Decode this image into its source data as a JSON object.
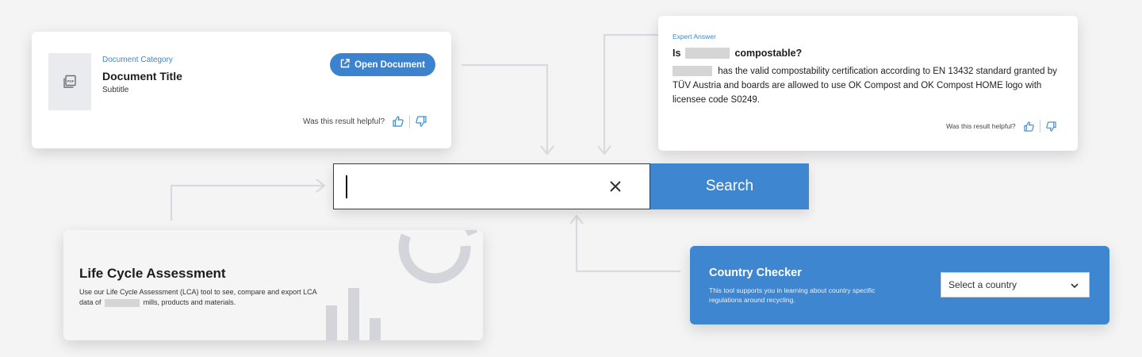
{
  "document_card": {
    "category": "Document Category",
    "title": "Document Title",
    "subtitle": "Subtitle",
    "thumb_icon": "pdf-file-icon",
    "open_button_icon": "external-link-icon",
    "open_button_label": "Open Document",
    "feedback_question": "Was this result helpful?",
    "thumbs_up_icon": "thumbs-up-icon",
    "thumbs_down_icon": "thumbs-down-icon"
  },
  "expert_card": {
    "label": "Expert Answer",
    "question_prefix": "Is",
    "question_suffix": "compostable?",
    "answer_text": "has the valid compostability certification according to EN 13432 standard granted by TÜV Austria and boards are allowed to use OK Compost and OK Compost HOME logo with licensee code S0249.",
    "feedback_question": "Was this result helpful?"
  },
  "search": {
    "input_value": "",
    "clear_icon": "close-icon",
    "button_label": "Search"
  },
  "lca_card": {
    "title": "Life Cycle Assessment",
    "desc_part1": "Use our Life Cycle Assessment (LCA) tool to see, compare and export LCA data of",
    "desc_part2": "mills, products and materials.",
    "graphic_icon": "chart-icon"
  },
  "country_card": {
    "title": "Country Checker",
    "description": "This tool supports you in learning about country specific regulations around recycling.",
    "select_placeholder": "Select a country",
    "select_icon": "chevron-down-icon"
  },
  "colors": {
    "accent": "#3f86d1",
    "link": "#3b87cf",
    "background": "#f4f4f5",
    "connector": "#d9dadf",
    "redaction": "#d5d5d5"
  }
}
